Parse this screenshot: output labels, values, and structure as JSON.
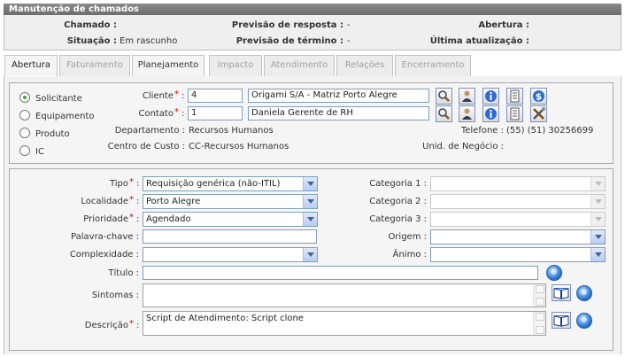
{
  "window": {
    "title": "Manutenção de chamados"
  },
  "info": {
    "chamado_label": "Chamado :",
    "situacao_label": "Situação :",
    "situacao_value": "Em rascunho",
    "prev_resposta_label": "Previsão de resposta :",
    "prev_resposta_value": "-",
    "prev_termino_label": "Previsão de término :",
    "prev_termino_value": "-",
    "abertura_label": "Abertura :",
    "ultima_label": "Última atualização :"
  },
  "tabs": [
    {
      "label": "Abertura",
      "state": "active"
    },
    {
      "label": "Faturamento",
      "state": "disabled"
    },
    {
      "label": "Planejamento",
      "state": "enabled"
    },
    {
      "label": "Impacto",
      "state": "disabled"
    },
    {
      "label": "Atendimento",
      "state": "disabled"
    },
    {
      "label": "Relações",
      "state": "disabled"
    },
    {
      "label": "Encerramento",
      "state": "disabled"
    }
  ],
  "radios": [
    {
      "label": "Solicitante",
      "checked": true
    },
    {
      "label": "Equipamento",
      "checked": false
    },
    {
      "label": "Produto",
      "checked": false
    },
    {
      "label": "IC",
      "checked": false
    }
  ],
  "requester": {
    "cliente_label": "Cliente",
    "cliente_code": "4",
    "cliente_name": "Origami S/A - Matriz Porto Alegre",
    "contato_label": "Contato",
    "contato_code": "1",
    "contato_name": "Daniela Gerente de RH",
    "departamento_label": "Departamento :",
    "departamento_value": "Recursos Humanos",
    "centro_label": "Centro de Custo :",
    "centro_value": "CC-Recursos Humanos",
    "telefone_label": "Telefone :",
    "telefone_value": "(55) (51) 30256699",
    "unid_label": "Unid. de Negócio :"
  },
  "form": {
    "tipo_label": "Tipo",
    "tipo_value": "Requisição genérica (não-ITIL)",
    "localidade_label": "Localidade",
    "localidade_value": "Porto Alegre",
    "prioridade_label": "Prioridade",
    "prioridade_value": "Agendado",
    "palavra_label": "Palavra-chave :",
    "complexidade_label": "Complexidade :",
    "titulo_label": "Título :",
    "sintomas_label": "Sintomas :",
    "descricao_label": "Descrição",
    "descricao_value": "Script de Atendimento: Script clone",
    "categoria1_label": "Categoria 1 :",
    "categoria2_label": "Categoria 2 :",
    "categoria3_label": "Categoria 3 :",
    "origem_label": "Origem :",
    "animo_label": "Ânimo :",
    "required_mark": "*",
    "colon": ":"
  },
  "icons": {
    "row1": [
      "search-icon",
      "user-icon",
      "info-icon",
      "document-icon",
      "dollar-icon"
    ],
    "row2": [
      "search-icon",
      "user-icon",
      "info-icon",
      "document-icon",
      "tools-icon"
    ]
  },
  "colors": {
    "title_bar": "#7a7a7a",
    "required": "#dd0000",
    "input_border": "#7f9db9"
  }
}
